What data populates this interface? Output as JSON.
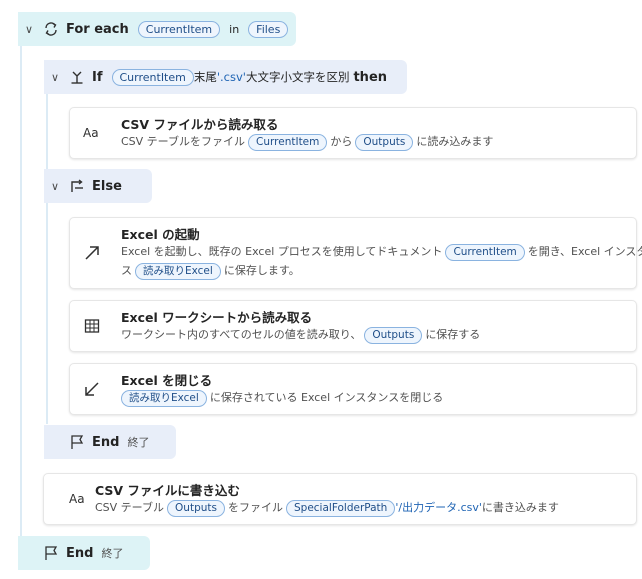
{
  "loop": {
    "keyword": "For each",
    "item_var": "CurrentItem",
    "in_text": "in",
    "collection_var": "Files"
  },
  "if_block": {
    "keyword": "If",
    "var": "CurrentItem",
    "op": "末尾",
    "value": "'.csv'",
    "modifier": "大文字小文字を区別",
    "then_kw": "then"
  },
  "csv_read": {
    "title": "CSV ファイルから読み取る",
    "desc_pre": "CSV テーブルをファイル",
    "var1": "CurrentItem",
    "desc_mid": "から",
    "var2": "Outputs",
    "desc_post": "に読み込みます"
  },
  "else_block": {
    "keyword": "Else"
  },
  "excel_launch": {
    "title": "Excel の起動",
    "desc_pre": "Excel を起動し、既存の Excel プロセスを使用してドキュメント",
    "var1": "CurrentItem",
    "desc_mid": "を開き、Excel インスタ",
    "desc_line2_pre": "ス",
    "var2": "読み取りExcel",
    "desc_post": "に保存します。"
  },
  "excel_read": {
    "title": "Excel ワークシートから読み取る",
    "desc_pre": "ワークシート内のすべてのセルの値を読み取り、",
    "var1": "Outputs",
    "desc_post": "に保存する"
  },
  "excel_close": {
    "title": "Excel を閉じる",
    "var1": "読み取りExcel",
    "desc_post": "に保存されている Excel インスタンスを閉じる"
  },
  "end_inner": {
    "keyword": "End",
    "label": "終了"
  },
  "csv_write": {
    "title": "CSV ファイルに書き込む",
    "desc_pre": "CSV テーブル",
    "var1": "Outputs",
    "desc_mid": "をファイル",
    "var2": "SpecialFolderPath",
    "path_str": "'/出力データ.csv'",
    "desc_post": "に書き込みます"
  },
  "end_outer": {
    "keyword": "End",
    "label": "終了"
  },
  "icons": {
    "loop": "loop-arrows-icon",
    "if": "branch-icon",
    "else": "branch-return-icon",
    "csv": "text-aa-icon",
    "excel_launch": "arrow-up-right-icon",
    "excel_read": "table-grid-icon",
    "excel_close": "arrow-down-left-icon",
    "end": "flag-icon"
  },
  "colors": {
    "loop_header": "#ddf3f6",
    "cond_header": "#e8eef9",
    "chip_border": "#8ab3e0",
    "chip_text": "#1f4e88",
    "string_literal": "#1f64b4"
  }
}
